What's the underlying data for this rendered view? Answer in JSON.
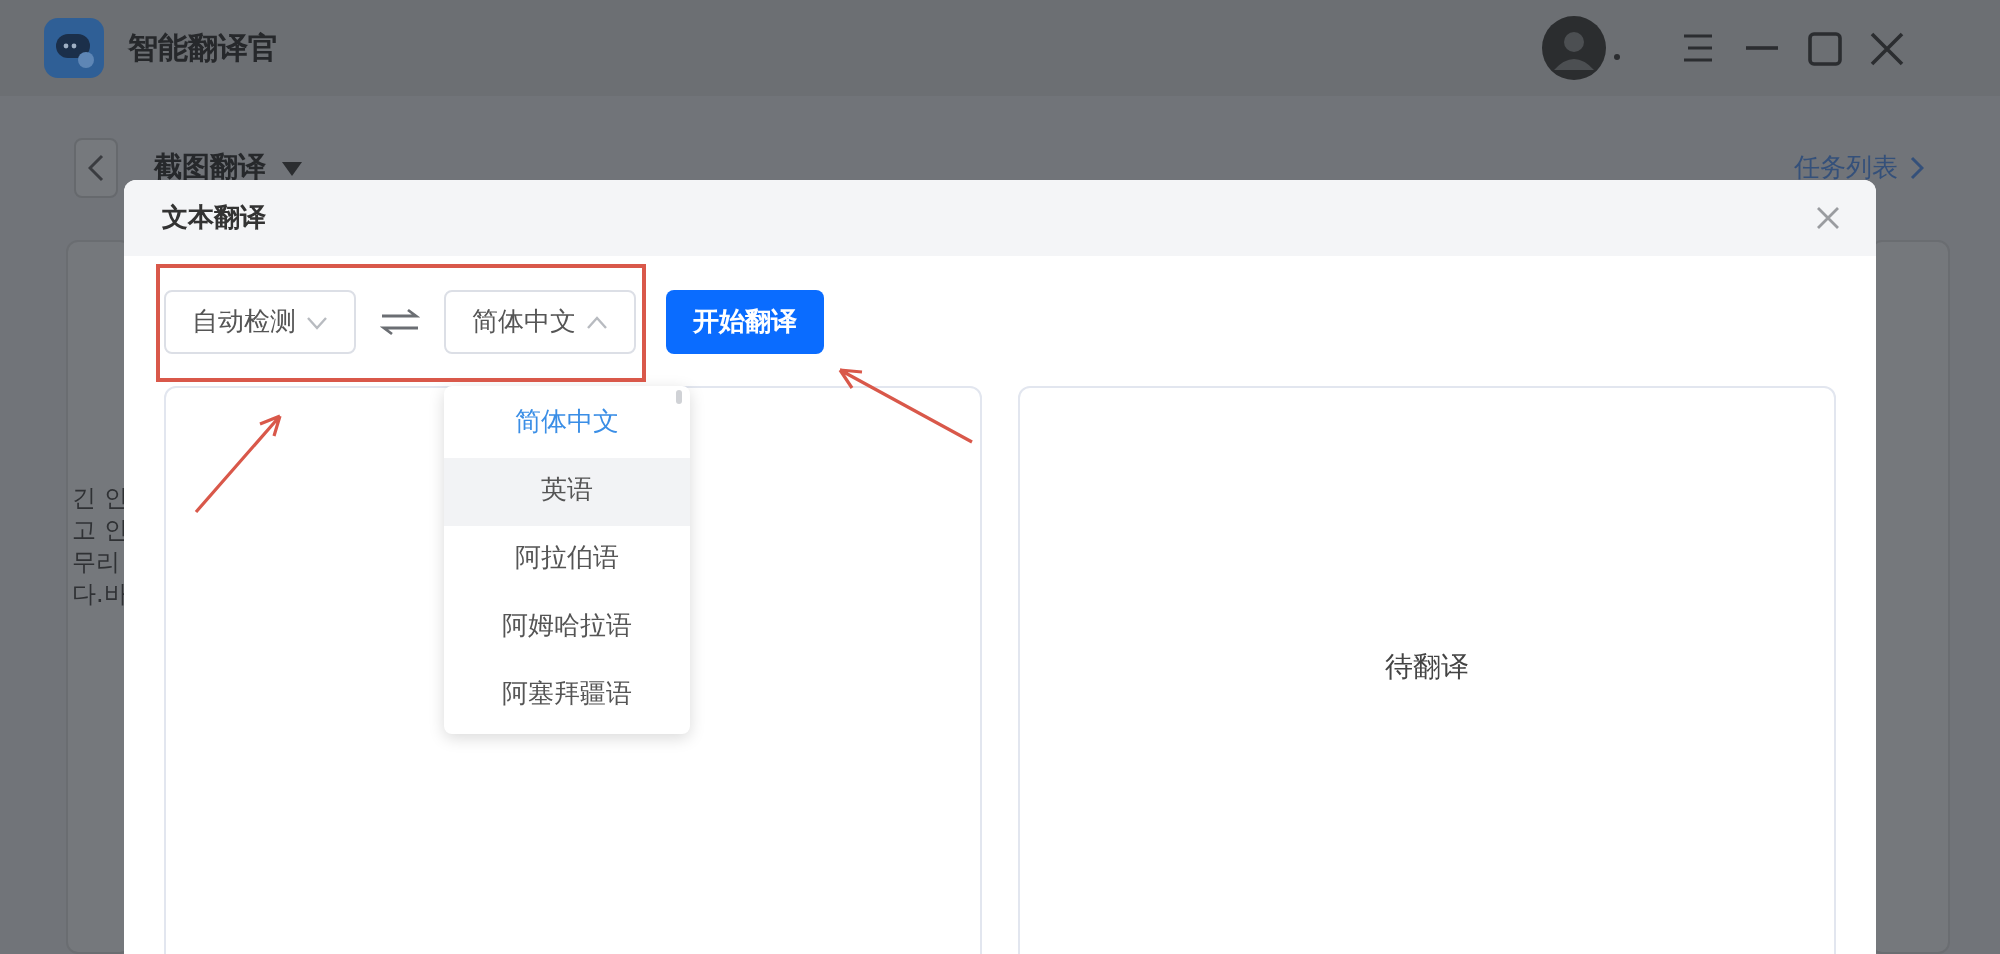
{
  "app": {
    "title": "智能翻译官"
  },
  "header": {
    "mode": "截图翻译",
    "task_list": "任务列表"
  },
  "background_text": [
    "긴 인",
    "고 인",
    "무리",
    "다.바"
  ],
  "dialog": {
    "title": "文本翻译",
    "source_language": "自动检测",
    "target_language": "简体中文",
    "target_open": true,
    "translate_button": "开始翻译",
    "dropdown": [
      {
        "label": "简体中文",
        "selected": true,
        "highlighted": false
      },
      {
        "label": "英语",
        "selected": false,
        "highlighted": true
      },
      {
        "label": "阿拉伯语",
        "selected": false,
        "highlighted": false
      },
      {
        "label": "阿姆哈拉语",
        "selected": false,
        "highlighted": false
      },
      {
        "label": "阿塞拜疆语",
        "selected": false,
        "highlighted": false
      }
    ],
    "output_placeholder": "待翻译"
  }
}
